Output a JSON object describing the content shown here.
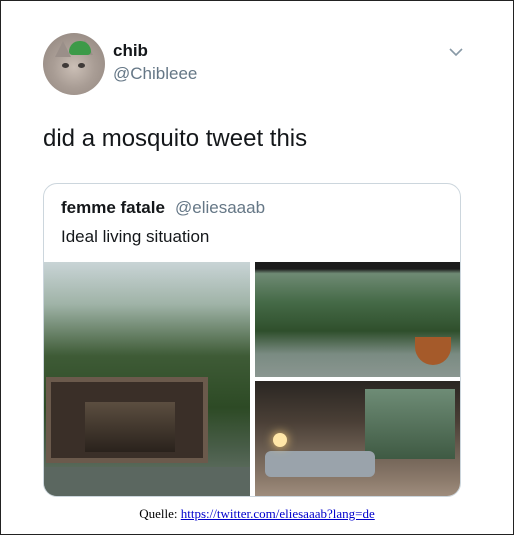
{
  "tweet": {
    "display_name": "chib",
    "handle": "@Chibleee",
    "text": "did a mosquito tweet this",
    "menu_icon": "chevron-down-icon"
  },
  "quoted_tweet": {
    "display_name": "femme fatale",
    "handle": "@eliesaaab",
    "text": "Ideal living situation",
    "images": [
      {
        "name": "jungle-cabin-on-river"
      },
      {
        "name": "rainforest-view-with-hammock"
      },
      {
        "name": "cabin-interior-bedroom"
      }
    ]
  },
  "source": {
    "label": "Quelle:",
    "link_text": "https://twitter.com/eliesaaab?lang=de"
  },
  "colors": {
    "text_primary": "#14171a",
    "text_secondary": "#657786",
    "card_border": "#ccd6dd",
    "link": "#0000cc"
  }
}
